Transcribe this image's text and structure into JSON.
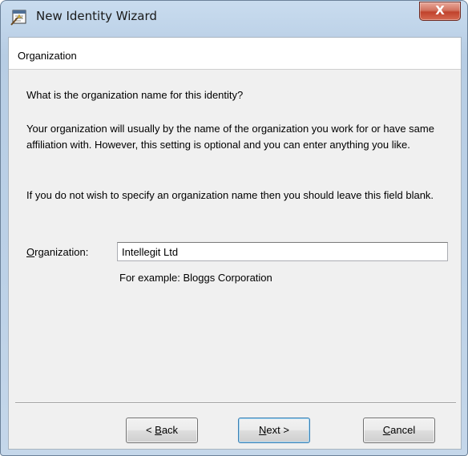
{
  "window": {
    "title": "New Identity Wizard",
    "close_glyph": "X",
    "icon": "wizard-app-icon"
  },
  "page": {
    "header": "Organization",
    "question": "What is the organization name for this identity?",
    "paragraph1": "Your organization will usually by the name of the organization you work for or have same affiliation with.  However, this setting is optional and you can enter anything you like.",
    "paragraph2": "If you do not wish to specify an organization name then you should leave this field blank."
  },
  "form": {
    "label_underlined": "O",
    "label_rest": "rganization:",
    "value": "Intellegit Ltd",
    "example": "For example: Bloggs Corporation"
  },
  "buttons": {
    "back_prefix": "< ",
    "back_underlined": "B",
    "back_rest": "ack",
    "next_underlined": "N",
    "next_rest": "ext >",
    "cancel_underlined": "C",
    "cancel_rest": "ancel"
  }
}
